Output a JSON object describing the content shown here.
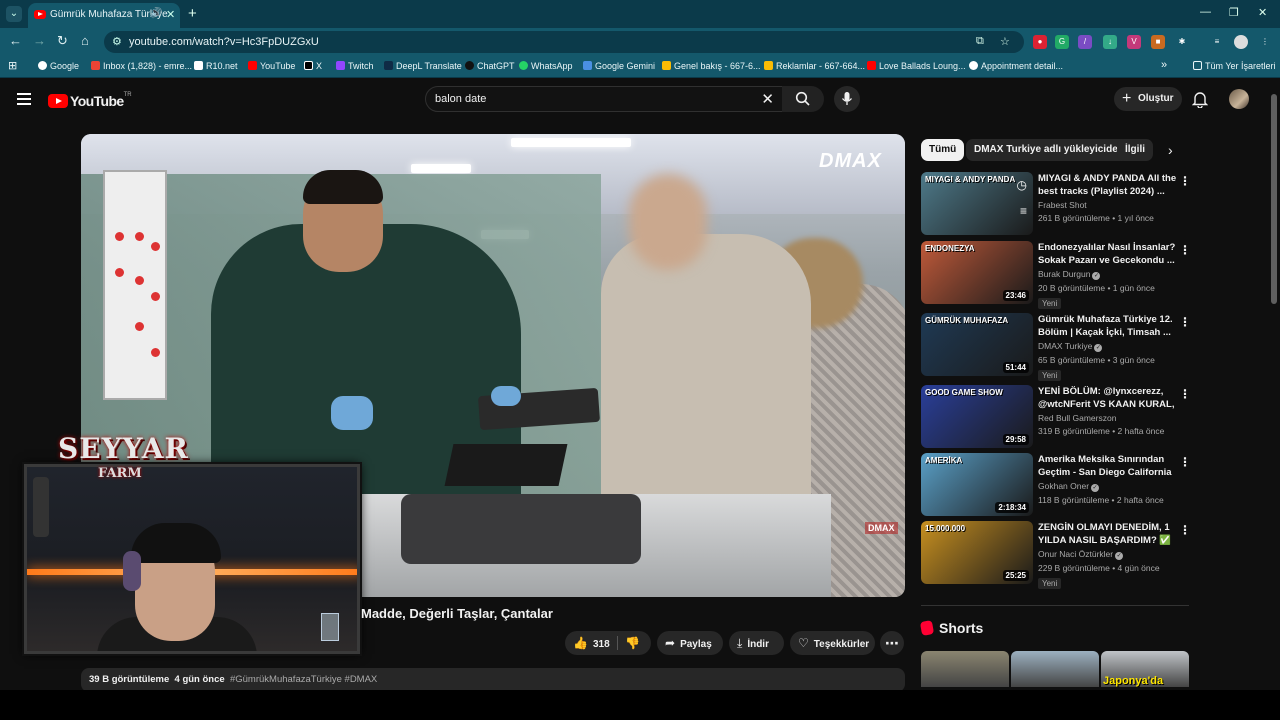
{
  "browser": {
    "tab_title": "Gümrük Muhafaza Türkiye",
    "url": "youtube.com/watch?v=Hc3FpDUZGxU",
    "bookmarks": [
      {
        "label": "Google",
        "color": "#ffffff"
      },
      {
        "label": "Inbox (1,828) - emre...",
        "color": "#ea4335"
      },
      {
        "label": "R10.net",
        "color": "#ffffff"
      },
      {
        "label": "YouTube",
        "color": "#ff0000"
      },
      {
        "label": "X",
        "color": "#000000"
      },
      {
        "label": "Twitch",
        "color": "#9146ff"
      },
      {
        "label": "DeepL Translate",
        "color": "#0f2b46"
      },
      {
        "label": "ChatGPT",
        "color": "#111111"
      },
      {
        "label": "WhatsApp",
        "color": "#25d366"
      },
      {
        "label": "Google Gemini",
        "color": "#4a90e2"
      },
      {
        "label": "Genel bakış - 667-6...",
        "color": "#fbbc04"
      },
      {
        "label": "Reklamlar - 667-664...",
        "color": "#fbbc04"
      },
      {
        "label": "Love Ballads Loung...",
        "color": "#ff0000"
      },
      {
        "label": "Appointment detail...",
        "color": "#ffffff"
      }
    ],
    "all_bookmarks": "Tüm Yer İşaretleri"
  },
  "youtube": {
    "logo_text": "YouTube",
    "logo_region": "TR",
    "search_value": "balon date",
    "create_label": "Oluştur"
  },
  "video": {
    "watermark": "DMAX",
    "watermark_small": "DMAX",
    "overlay_title": "SEYYAR",
    "overlay_subtitle": "FARM",
    "title": "Madde, Değerli Taşlar, Çantalar",
    "likes": "318",
    "share_label": "Paylaş",
    "download_label": "İndir",
    "thanks_label": "Teşekkürler",
    "views": "39 B görüntüleme",
    "age": "4 gün önce",
    "tags": "#GümrükMuhafazaTürkiye #DMAX"
  },
  "chips": [
    "Tümü",
    "DMAX Turkiye adlı yükleyiciden",
    "İlgili"
  ],
  "recommendations": [
    {
      "title": "MIYAGI & ANDY PANDA All the best tracks (Playlist 2024) ...",
      "channel": "Frabest Shot",
      "verified": false,
      "meta": "261 B görüntüleme • 1 yıl önce",
      "duration": "",
      "new": "",
      "thumb_text": "MIYAGI & ANDY PANDA",
      "thumb_color": "#4e7a8a"
    },
    {
      "title": "Endonezyalılar Nasıl İnsanlar? Sokak Pazarı ve Gecekondu ...",
      "channel": "Burak Durgun",
      "verified": true,
      "meta": "20 B görüntüleme • 1 gün önce",
      "duration": "23:46",
      "new": "Yeni",
      "thumb_text": "ENDONEZYA",
      "thumb_color": "#c05a3a"
    },
    {
      "title": "Gümrük Muhafaza Türkiye 12. Bölüm | Kaçak İçki, Timsah ...",
      "channel": "DMAX Turkiye",
      "verified": true,
      "meta": "65 B görüntüleme • 3 gün önce",
      "duration": "51:44",
      "new": "Yeni",
      "thumb_text": "GÜMRÜK MUHAFAZA",
      "thumb_color": "#1f3a55"
    },
    {
      "title": "YENİ BÖLÜM: @lynxcerezz, @wtcNFerit VS KAAN KURAL, ...",
      "channel": "Red Bull Gamerszon",
      "verified": false,
      "meta": "319 B görüntüleme • 2 hafta önce",
      "duration": "29:58",
      "new": "",
      "thumb_text": "GOOD GAME SHOW",
      "thumb_color": "#2a3f9a"
    },
    {
      "title": "Amerika Meksika Sınırından Geçtim - San Diego California ...",
      "channel": "Gokhan Oner",
      "verified": true,
      "meta": "118 B görüntüleme • 2 hafta önce",
      "duration": "2:18:34",
      "new": "",
      "thumb_text": "AMERİKA",
      "thumb_color": "#5aa0c8"
    },
    {
      "title": "ZENGİN OLMAYI DENEDİM, 1 YILDA NASIL BAŞARDIM? ✅ ...",
      "channel": "Onur Naci Öztürkler",
      "verified": true,
      "meta": "229 B görüntüleme • 4 gün önce",
      "duration": "25:25",
      "new": "Yeni",
      "thumb_text": "15.000.000",
      "thumb_color": "#c89020"
    }
  ],
  "shorts": {
    "title": "Shorts",
    "items": [
      {
        "caption": "",
        "color": "#8a8570"
      },
      {
        "caption": "",
        "color": "#9cb0c0"
      },
      {
        "caption": "Japonya'da",
        "color": "#c0c4c8"
      }
    ]
  }
}
